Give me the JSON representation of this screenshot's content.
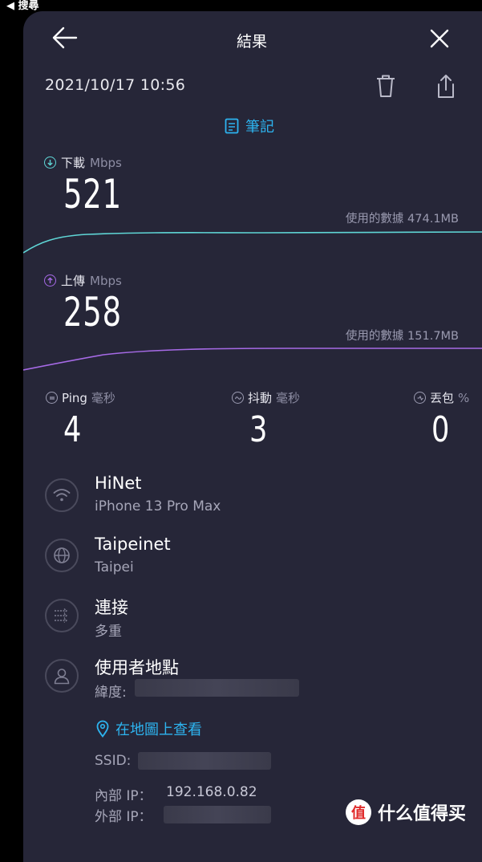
{
  "status_bar": {
    "back_label": "◀ 搜尋"
  },
  "header": {
    "title": "結果"
  },
  "result": {
    "datetime": "2021/10/17 10:56",
    "notes_label": "筆記",
    "download": {
      "label": "下載",
      "unit": "Mbps",
      "value": "521",
      "data_used": "使用的數據 474.1MB"
    },
    "upload": {
      "label": "上傳",
      "unit": "Mbps",
      "value": "258",
      "data_used": "使用的數據 151.7MB"
    },
    "ping": {
      "label": "Ping",
      "unit": "毫秒",
      "value": "4"
    },
    "jitter": {
      "label": "抖動",
      "unit": "毫秒",
      "value": "3"
    },
    "loss": {
      "label": "丟包",
      "unit": "%",
      "value": "0"
    }
  },
  "info": {
    "network": {
      "title": "HiNet",
      "sub": "iPhone 13 Pro Max"
    },
    "server": {
      "title": "Taipeinet",
      "sub": "Taipei"
    },
    "connection": {
      "title": "連接",
      "sub": "多重"
    },
    "location": {
      "title": "使用者地點",
      "lat_label": "緯度:"
    },
    "map_link": "在地圖上查看",
    "ssid_label": "SSID:",
    "internal_ip_label": "內部 IP：",
    "internal_ip": "192.168.0.82",
    "external_ip_label": "外部 IP："
  },
  "watermark": {
    "logo_char": "值",
    "text": "什么值得买"
  },
  "colors": {
    "panel": "#262638",
    "download_line": "#5fd6d6",
    "upload_line": "#a66ae6",
    "accent": "#2db4f0"
  }
}
